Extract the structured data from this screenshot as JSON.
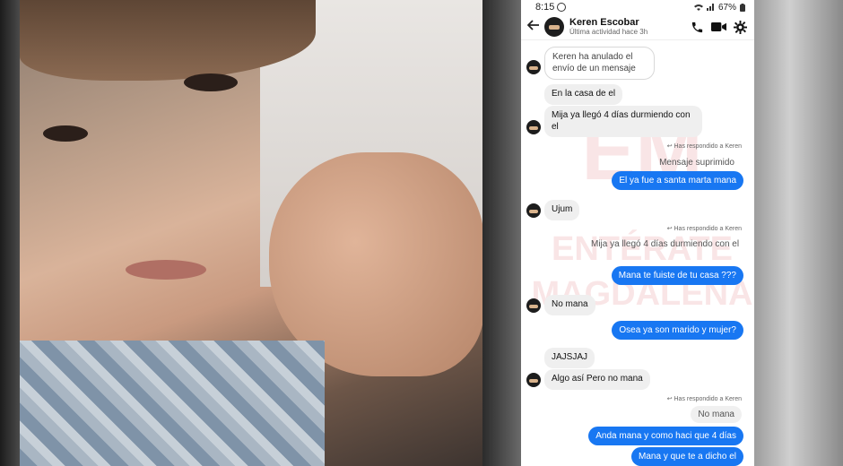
{
  "status_bar": {
    "time": "8:15",
    "battery": "67%"
  },
  "header": {
    "name": "Keren Escobar",
    "subtitle": "Última actividad hace 3h"
  },
  "watermark": {
    "line1": "EM",
    "line2": "ENTÉRATE",
    "line3": "MAGDALENA"
  },
  "messages": {
    "m1": "Keren ha anulado el envío de un mensaje",
    "m2": "En la casa de el",
    "m3": "Mija ya llegó 4 días durmiendo con el",
    "reply1": "Has respondido a Keren",
    "quoted1": "Mensaje suprimido",
    "out1": "El ya fue a santa marta mana",
    "m4": "Ujum",
    "reply2": "Has respondido a Keren",
    "quoted2": "Mija ya llegó 4 días durmiendo con el",
    "out2": "Mana te fuiste de tu casa ???",
    "m5": "No mana",
    "out3": "Osea ya son marido y mujer?",
    "m6": "JAJSJAJ",
    "m7": "Algo así Pero no mana",
    "reply3": "Has respondido a Keren",
    "quoted3": "No mana",
    "out4": "Anda mana y como haci que 4 días",
    "out5": "Mana y que te a dicho el"
  },
  "colors": {
    "accent": "#1877f2",
    "incoming_bubble": "#efefef"
  },
  "icons": [
    "back-arrow-icon",
    "phone-icon",
    "video-icon",
    "gear-icon",
    "reply-icon",
    "wifi-icon",
    "signal-icon",
    "battery-icon",
    "whatsapp-icon"
  ]
}
